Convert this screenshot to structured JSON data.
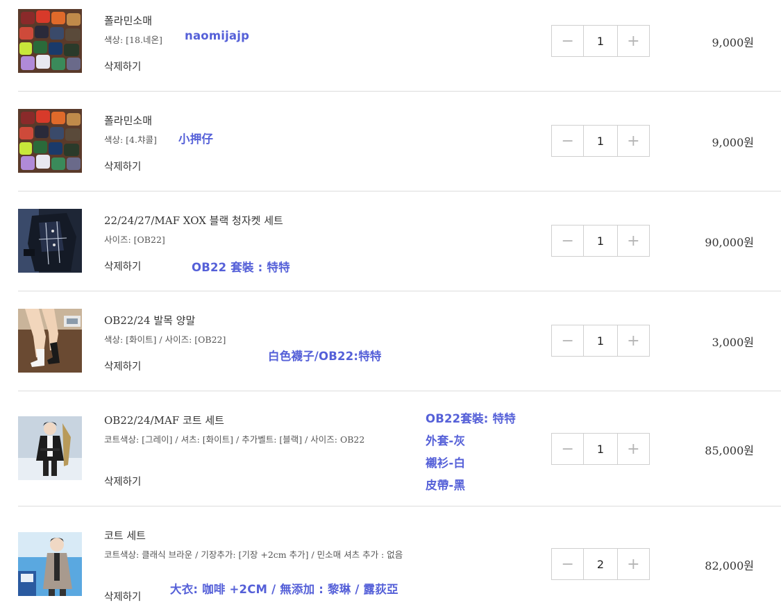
{
  "colors": {
    "annotation": "#5560d8",
    "divider": "#dcdcdc",
    "stepper_icon": "#b5b5b5"
  },
  "items": [
    {
      "name": "폴라민소매",
      "options": "색상: [18.네온]",
      "delete_label": "삭제하기",
      "quantity": "1",
      "price": "9,000원",
      "minus": "−",
      "plus": "+",
      "note": [
        "naomijajp"
      ]
    },
    {
      "name": "폴라민소매",
      "options": "색상: [4.챠콜]",
      "delete_label": "삭제하기",
      "quantity": "1",
      "price": "9,000원",
      "minus": "−",
      "plus": "+",
      "note": [
        "小押仔"
      ]
    },
    {
      "name": "22/24/27/MAF XOX 블랙 청자켓 세트",
      "options": "사이즈: [OB22]",
      "delete_label": "삭제하기",
      "quantity": "1",
      "price": "90,000원",
      "minus": "−",
      "plus": "+",
      "note": [
        "OB22 套裝 : 特特"
      ]
    },
    {
      "name": "OB22/24 발목 양말",
      "options": "색상: [화이트] / 사이즈: [OB22]",
      "delete_label": "삭제하기",
      "quantity": "1",
      "price": "3,000원",
      "minus": "−",
      "plus": "+",
      "note": [
        "白色襪子/OB22:特特"
      ]
    },
    {
      "name": "OB22/24/MAF 코트 세트",
      "options": "코트색상: [그레이] / 셔츠: [화이트] / 추가벨트: [블랙] / 사이즈: OB22",
      "delete_label": "삭제하기",
      "quantity": "1",
      "price": "85,000원",
      "minus": "−",
      "plus": "+",
      "note": [
        "OB22套裝: 特特",
        "外套-灰",
        "襯衫-白",
        "皮帶-黑"
      ]
    },
    {
      "name": "코트 세트",
      "options": "코트색상: 클래식 브라운 / 기장추가: [기장 +2cm 추가] / 민소매 셔츠 추가 : 없음",
      "delete_label": "삭제하기",
      "quantity": "2",
      "price": "82,000원",
      "minus": "−",
      "plus": "+",
      "note": [
        "大衣: 咖啡 +2CM / 無添加 : 黎琳 / 露荻亞"
      ]
    }
  ]
}
